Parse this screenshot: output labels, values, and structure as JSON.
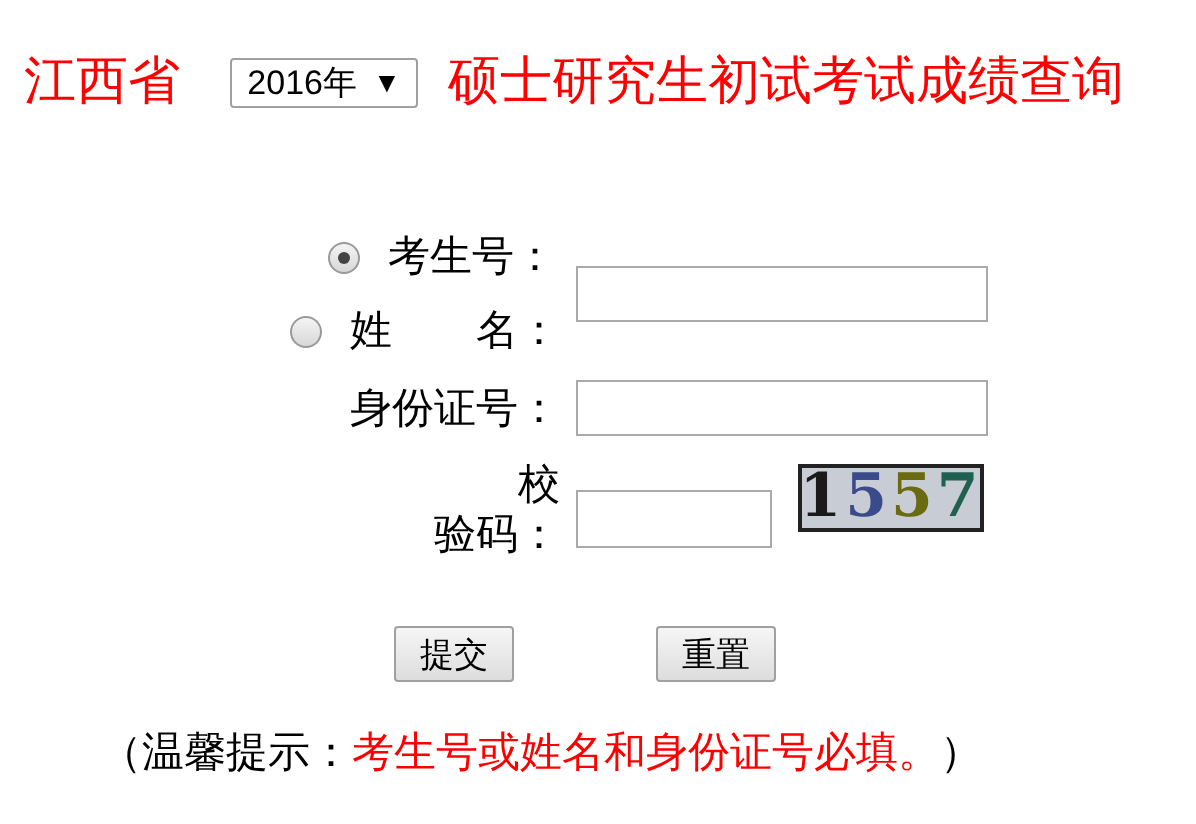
{
  "header": {
    "province": "江西省",
    "year_select": {
      "value": "2016年",
      "arrow": "▼"
    },
    "title": "硕士研究生初试考试成绩查询"
  },
  "form": {
    "id_choices": [
      {
        "label": "考生号：",
        "selected": true
      },
      {
        "label": "姓　　名：",
        "selected": false
      }
    ],
    "id_number_label": "身份证号：",
    "captcha_label_lines": [
      "校",
      "验码："
    ],
    "captcha": {
      "code": "1557"
    },
    "buttons": [
      "提交",
      "重置"
    ]
  },
  "notice": {
    "prefix": "（温馨提示：",
    "text": "考生号或姓名和身份证号必填。",
    "suffix": "）"
  }
}
